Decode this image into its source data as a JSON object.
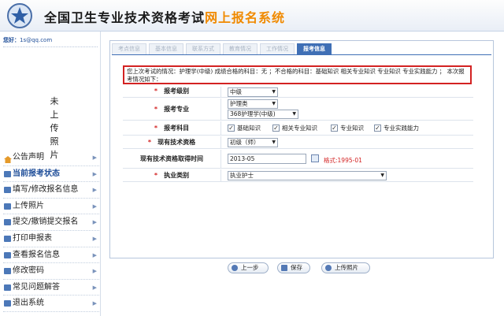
{
  "header": {
    "title_main": "全国卫生专业技术资格考试",
    "title_accent": "网上报名系统",
    "accent_color": "#f08a00"
  },
  "sidebar": {
    "greeting_prefix": "您好：",
    "greeting_user": "1s@qq.com",
    "photo_text": "未上传照片",
    "menu": [
      {
        "label": "公告声明",
        "icon": "house-icon"
      },
      {
        "label": "当前报考状态",
        "icon": "doc-icon",
        "active": true
      },
      {
        "label": "填写/修改报名信息",
        "icon": "doc-icon"
      },
      {
        "label": "上传照片",
        "icon": "doc-icon"
      },
      {
        "label": "提交/撤销提交报名",
        "icon": "doc-icon"
      },
      {
        "label": "打印申报表",
        "icon": "doc-icon"
      },
      {
        "label": "查看报名信息",
        "icon": "doc-icon"
      },
      {
        "label": "修改密码",
        "icon": "doc-icon"
      },
      {
        "label": "常见问题解答",
        "icon": "doc-icon"
      },
      {
        "label": "退出系统",
        "icon": "doc-icon"
      }
    ]
  },
  "tabs": [
    "考点信息",
    "基本信息",
    "联系方式",
    "教育情况",
    "工作情况",
    "报考信息"
  ],
  "active_tab": "报考信息",
  "notice": "您上次考试的情况：护理学(中级) 成绩合格的科目：无 ；不合格的科目：基础知识 相关专业知识 专业知识 专业实践能力 ； 本次报考情况如下：",
  "form": {
    "level_label": "报考级别",
    "level_value": "中级",
    "major_label": "报考专业",
    "major_category": "护理类",
    "major_value": "368护理学(中级)",
    "subjects_label": "报考科目",
    "subjects": [
      "基础知识",
      "相关专业知识",
      "专业知识",
      "专业实践能力"
    ],
    "current_title_label": "现有技术资格",
    "current_title_value": "初级（师）",
    "date_label": "现有技术资格取得时间",
    "date_value": "2013-05",
    "date_format_hint": "格式:1995-01",
    "practice_label": "执业类别",
    "practice_value": "执业护士"
  },
  "buttons": {
    "prev": "上一步",
    "save": "保存",
    "upload": "上传照片"
  },
  "colors": {
    "required_star": "#d32222",
    "tab_active": "#3f6fb5",
    "notice_border": "#d32222"
  }
}
